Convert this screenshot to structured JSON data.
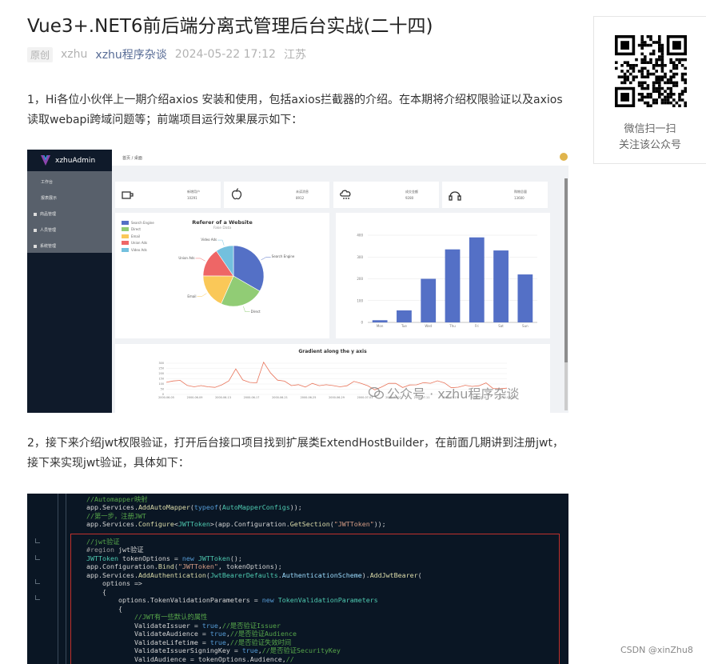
{
  "article": {
    "title": "Vue3+.NET6前后端分离式管理后台实战(二十四)",
    "meta": {
      "badge": "原创",
      "author": "xzhu",
      "account": "xzhu程序杂谈",
      "time": "2024-05-22 17:12",
      "location": "江苏"
    },
    "paragraph1": "1，Hi各位小伙伴上一期介绍axios 安装和使用，包括axios拦截器的介绍。在本期将介绍权限验证以及axios读取webapi跨域问题等；前端项目运行效果展示如下：",
    "paragraph2": "2，接下来介绍jwt权限验证，打开后台接口项目找到扩展类ExtendHostBuilder，在前面几期讲到注册jwt，接下来实现jwt验证，具体如下："
  },
  "screenshot1": {
    "app_name": "xzhuAdmin",
    "breadcrumb": "首页 / 桌面",
    "user": "xzhu",
    "menu": [
      {
        "label": "工作台",
        "sub": true
      },
      {
        "label": "报表展示",
        "sub": true
      },
      {
        "label": "商品管理",
        "sub": false
      },
      {
        "label": "人员管理",
        "sub": false
      },
      {
        "label": "系统管理",
        "sub": false
      }
    ],
    "stats": [
      {
        "label": "新增用户",
        "value": "10291",
        "icon": "cup-icon"
      },
      {
        "label": "未读消息",
        "value": "8912",
        "icon": "apple-icon"
      },
      {
        "label": "成交金额",
        "value": "9280",
        "icon": "cloud-icon"
      },
      {
        "label": "购物总量",
        "value": "13600",
        "icon": "headphones-icon"
      }
    ],
    "watermark": "公众号 · xzhu程序杂谈"
  },
  "chart_data": [
    {
      "type": "pie",
      "title": "Referer of a Website",
      "subtitle": "Fake Data",
      "categories": [
        "Search Engine",
        "Direct",
        "Email",
        "Union Ads",
        "Video Ads"
      ],
      "values": [
        1048,
        735,
        580,
        484,
        300
      ],
      "colors": [
        "#5470c6",
        "#91cc75",
        "#fac858",
        "#ee6666",
        "#73c0de"
      ],
      "legend": "top-left"
    },
    {
      "type": "bar",
      "categories": [
        "Mon",
        "Tue",
        "Wed",
        "Thu",
        "Fri",
        "Sat",
        "Sun"
      ],
      "values": [
        10,
        55,
        200,
        335,
        390,
        330,
        220
      ],
      "ylim": [
        0,
        400
      ],
      "yticks": [
        "0",
        "100",
        "200",
        "300",
        "400"
      ],
      "color": "#5470c6",
      "grid": true
    },
    {
      "type": "line",
      "title": "Gradient along the y axis",
      "yticks": [
        "0",
        "50",
        "100",
        "150",
        "200",
        "250",
        "300"
      ],
      "x": [
        "2000-06-05",
        "2000-06-09",
        "2000-06-13",
        "2000-06-17",
        "2000-06-21",
        "2000-06-25",
        "2000-06-29",
        "2000-07-03",
        "2000-07-07",
        "2000-07-11",
        "2000-07-15",
        "2000-07-19",
        "2000-07-23"
      ],
      "values": [
        116,
        129,
        135,
        86,
        73,
        85,
        73,
        68,
        92,
        130,
        245,
        139,
        115,
        111,
        309,
        206,
        137,
        128,
        85,
        94,
        71,
        106,
        84,
        93,
        85,
        73,
        83,
        125,
        107,
        82,
        44,
        72,
        106,
        107,
        66,
        91,
        92,
        113,
        107,
        131,
        111,
        64,
        69,
        88,
        77,
        83,
        111,
        57,
        55,
        60
      ],
      "ylim": [
        0,
        300
      ],
      "grid": true
    }
  ],
  "code": {
    "lines": [
      [
        {
          "c": "c-cm",
          "t": "//Automapper映射"
        }
      ],
      [
        {
          "c": "c-tx",
          "t": "app.Services."
        },
        {
          "c": "c-fn",
          "t": "AddAutoMapper"
        },
        {
          "c": "c-tx",
          "t": "("
        },
        {
          "c": "c-kw",
          "t": "typeof"
        },
        {
          "c": "c-tx",
          "t": "("
        },
        {
          "c": "c-ty",
          "t": "AutoMapperConfigs"
        },
        {
          "c": "c-tx",
          "t": "));"
        }
      ],
      [
        {
          "c": "c-cm",
          "t": "//第一步，注册JWT"
        }
      ],
      [
        {
          "c": "c-tx",
          "t": "app.Services."
        },
        {
          "c": "c-fn",
          "t": "Configure"
        },
        {
          "c": "c-tx",
          "t": "<"
        },
        {
          "c": "c-ty",
          "t": "JWTToken"
        },
        {
          "c": "c-tx",
          "t": ">(app.Configuration."
        },
        {
          "c": "c-fn",
          "t": "GetSection"
        },
        {
          "c": "c-tx",
          "t": "("
        },
        {
          "c": "c-st",
          "t": "\"JWTToken\""
        },
        {
          "c": "c-tx",
          "t": "));"
        }
      ],
      [],
      [
        {
          "c": "c-cm",
          "t": "//jwt验证"
        }
      ],
      [
        {
          "c": "c-rg",
          "t": "#region "
        },
        {
          "c": "c-tx",
          "t": "jwt验证"
        }
      ],
      [
        {
          "c": "c-ty",
          "t": "JWTToken"
        },
        {
          "c": "c-tx",
          "t": " tokenOptions = "
        },
        {
          "c": "c-kw",
          "t": "new"
        },
        {
          "c": "c-tx",
          "t": " "
        },
        {
          "c": "c-ty",
          "t": "JWTToken"
        },
        {
          "c": "c-tx",
          "t": "();"
        }
      ],
      [
        {
          "c": "c-tx",
          "t": "app.Configuration."
        },
        {
          "c": "c-fn",
          "t": "Bind"
        },
        {
          "c": "c-tx",
          "t": "("
        },
        {
          "c": "c-st",
          "t": "\"JWTToken\""
        },
        {
          "c": "c-tx",
          "t": ", tokenOptions);"
        }
      ],
      [
        {
          "c": "c-tx",
          "t": "app.Services."
        },
        {
          "c": "c-fn",
          "t": "AddAuthentication"
        },
        {
          "c": "c-tx",
          "t": "("
        },
        {
          "c": "c-ty",
          "t": "JwtBearerDefaults"
        },
        {
          "c": "c-tx",
          "t": "."
        },
        {
          "c": "c-pr",
          "t": "AuthenticationScheme"
        },
        {
          "c": "c-tx",
          "t": ")."
        },
        {
          "c": "c-fn",
          "t": "AddJwtBearer"
        },
        {
          "c": "c-tx",
          "t": "("
        }
      ],
      [
        {
          "c": "c-tx",
          "t": "    options =>"
        }
      ],
      [
        {
          "c": "c-tx",
          "t": "    {"
        }
      ],
      [
        {
          "c": "c-tx",
          "t": "        options.TokenValidationParameters = "
        },
        {
          "c": "c-kw",
          "t": "new"
        },
        {
          "c": "c-tx",
          "t": " "
        },
        {
          "c": "c-ty",
          "t": "TokenValidationParameters"
        }
      ],
      [
        {
          "c": "c-tx",
          "t": "        {"
        }
      ],
      [
        {
          "c": "c-cm",
          "t": "            //JWT有一些默认的属性"
        }
      ],
      [
        {
          "c": "c-tx",
          "t": "            ValidateIssuer = "
        },
        {
          "c": "c-kw",
          "t": "true"
        },
        {
          "c": "c-tx",
          "t": ","
        },
        {
          "c": "c-cm",
          "t": "//是否验证Issuer"
        }
      ],
      [
        {
          "c": "c-tx",
          "t": "            ValidateAudience = "
        },
        {
          "c": "c-kw",
          "t": "true"
        },
        {
          "c": "c-tx",
          "t": ","
        },
        {
          "c": "c-cm",
          "t": "//是否验证Audience"
        }
      ],
      [
        {
          "c": "c-tx",
          "t": "            ValidateLifetime = "
        },
        {
          "c": "c-kw",
          "t": "true"
        },
        {
          "c": "c-tx",
          "t": ","
        },
        {
          "c": "c-cm",
          "t": "//是否验证失效时间"
        }
      ],
      [
        {
          "c": "c-tx",
          "t": "            ValidateIssuerSigningKey = "
        },
        {
          "c": "c-kw",
          "t": "true"
        },
        {
          "c": "c-tx",
          "t": ","
        },
        {
          "c": "c-cm",
          "t": "//是否验证SecurityKey"
        }
      ],
      [
        {
          "c": "c-tx",
          "t": "            ValidAudience = tokenOptions.Audience,"
        },
        {
          "c": "c-cm",
          "t": "//"
        }
      ]
    ]
  },
  "qr": {
    "line1": "微信扫一扫",
    "line2": "关注该公众号"
  },
  "footer": {
    "csdn": "CSDN @xinZhu8"
  }
}
